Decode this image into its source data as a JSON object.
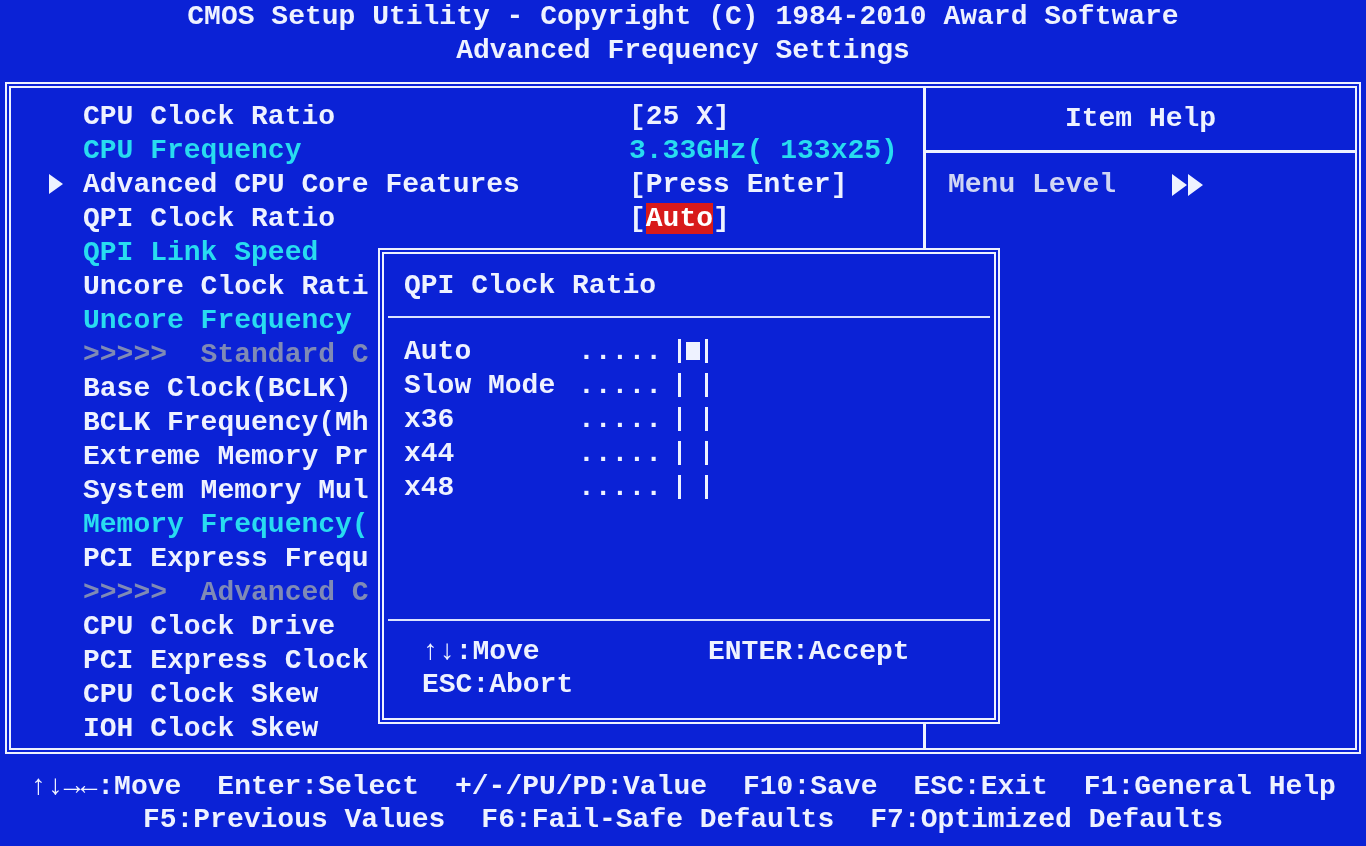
{
  "title_lines": [
    "CMOS Setup Utility - Copyright (C) 1984-2010 Award Software",
    "Advanced Frequency Settings"
  ],
  "menu": [
    {
      "kind": "item",
      "label": "CPU Clock Ratio",
      "open": "[",
      "value": "25 X",
      "close": "]",
      "selected": false
    },
    {
      "kind": "info",
      "label": "CPU Frequency",
      "value": "3.33GHz( 133x25)",
      "selected": false
    },
    {
      "kind": "submenu",
      "label": "Advanced CPU Core Features",
      "open": "[",
      "value": "Press Enter",
      "close": "]",
      "selected": false
    },
    {
      "kind": "item",
      "label": "QPI Clock Ratio",
      "open": "[",
      "value": "Auto",
      "close": "]",
      "selected": true
    },
    {
      "kind": "info",
      "label": "QPI Link Speed"
    },
    {
      "kind": "item",
      "label": "Uncore Clock Rati"
    },
    {
      "kind": "info",
      "label": "Uncore Frequency"
    },
    {
      "kind": "header",
      "label": ">>>>>  Standard C"
    },
    {
      "kind": "item",
      "label": "Base Clock(BCLK)"
    },
    {
      "kind": "item",
      "label": "BCLK Frequency(Mh"
    },
    {
      "kind": "item",
      "label": "Extreme Memory Pr"
    },
    {
      "kind": "item",
      "label": "System Memory Mul"
    },
    {
      "kind": "info",
      "label": "Memory Frequency("
    },
    {
      "kind": "item",
      "label": "PCI Express Frequ"
    },
    {
      "kind": "header",
      "label": ">>>>>  Advanced C"
    },
    {
      "kind": "item",
      "label": "CPU Clock Drive"
    },
    {
      "kind": "item",
      "label": "PCI Express Clock"
    },
    {
      "kind": "item",
      "label": "CPU Clock Skew"
    },
    {
      "kind": "item",
      "label": "IOH Clock Skew"
    }
  ],
  "help_panel": {
    "title": "Item Help",
    "menu_level_label": "Menu Level"
  },
  "popup": {
    "title": "QPI Clock Ratio",
    "options": [
      {
        "label": "Auto",
        "leader": ".....",
        "selected": true
      },
      {
        "label": "Slow Mode",
        "leader": ".....",
        "selected": false
      },
      {
        "label": "x36",
        "leader": ".....",
        "selected": false
      },
      {
        "label": "x44",
        "leader": ".....",
        "selected": false
      },
      {
        "label": "x48",
        "leader": ".....",
        "selected": false
      }
    ],
    "keys": [
      [
        "↑↓:Move",
        "ENTER:Accept"
      ],
      [
        "ESC:Abort"
      ]
    ]
  },
  "footer": [
    [
      "↑↓→←:Move",
      "Enter:Select",
      "+/-/PU/PD:Value",
      "F10:Save",
      "ESC:Exit",
      "F1:General Help"
    ],
    [
      "F5:Previous Values",
      "F6:Fail-Safe Defaults",
      "F7:Optimized Defaults"
    ]
  ]
}
